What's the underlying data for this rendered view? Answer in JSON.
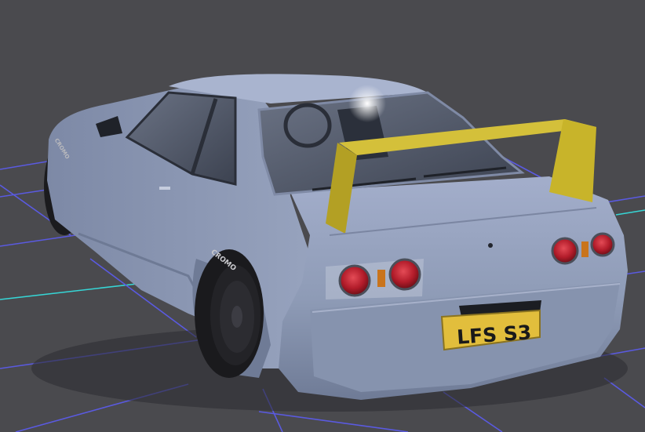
{
  "viewport": {
    "background_color": "#4a4a4e",
    "grid_colors": {
      "blue": "#5a5ae0",
      "cyan": "#36d6d6"
    }
  },
  "car": {
    "body_color": "#8e9bb6",
    "wing_color": "#c8b42a",
    "plate_color": "#e2be3c",
    "license_plate": "LFS S3",
    "tire_brand": "CROMO"
  }
}
